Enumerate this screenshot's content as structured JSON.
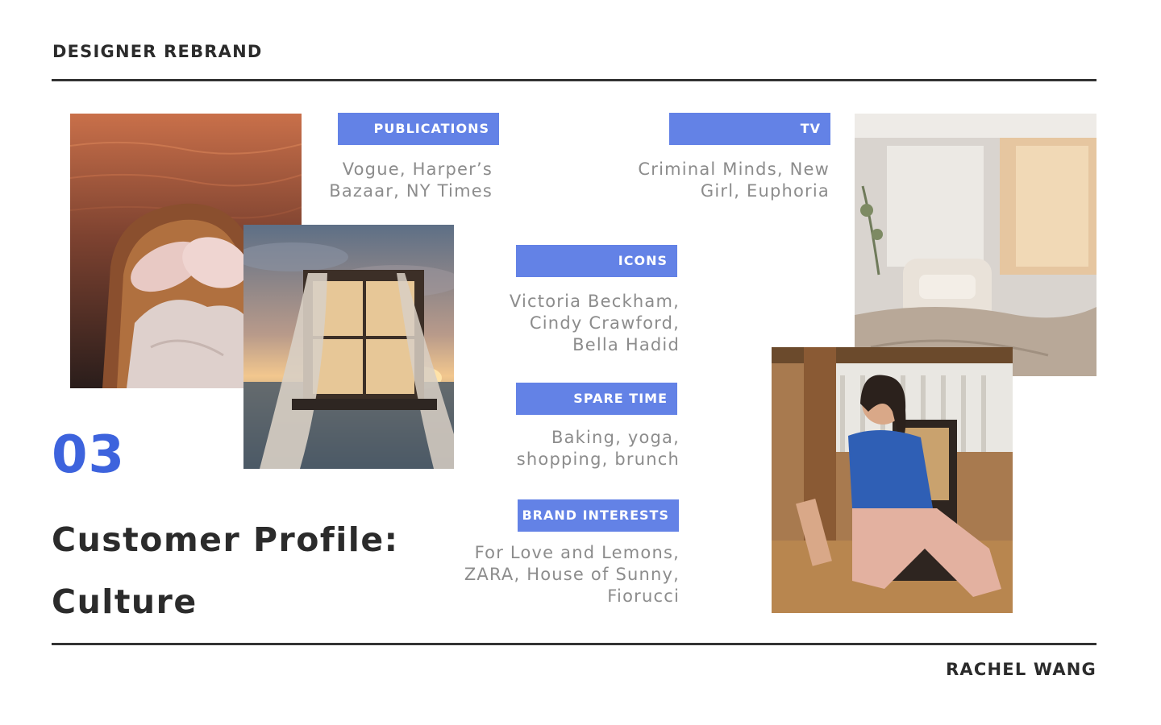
{
  "header": {
    "title": "DESIGNER REBRAND"
  },
  "footer": {
    "author": "RACHEL WANG"
  },
  "section": {
    "number": "03",
    "title": "Customer Profile: Culture"
  },
  "categories": {
    "publications": {
      "label": "PUBLICATIONS",
      "text": "Vogue, Harper’s Bazaar, NY Times"
    },
    "tv": {
      "label": "TV",
      "text": "Criminal Minds, New Girl, Euphoria"
    },
    "icons": {
      "label": "ICONS",
      "text": "Victoria Beckham, Cindy Crawford, Bella Hadid"
    },
    "spare_time": {
      "label": "SPARE TIME",
      "text": "Baking, yoga, shopping, brunch"
    },
    "brand_interests": {
      "label": "BRAND INTERESTS",
      "text": "For Love and Lemons, ZARA, House of Sunny, Fiorucci"
    }
  },
  "colors": {
    "accent": "#3d63dd",
    "tag_background": "#6382e6",
    "rule": "#333333",
    "body_text": "#8c8c8c"
  }
}
